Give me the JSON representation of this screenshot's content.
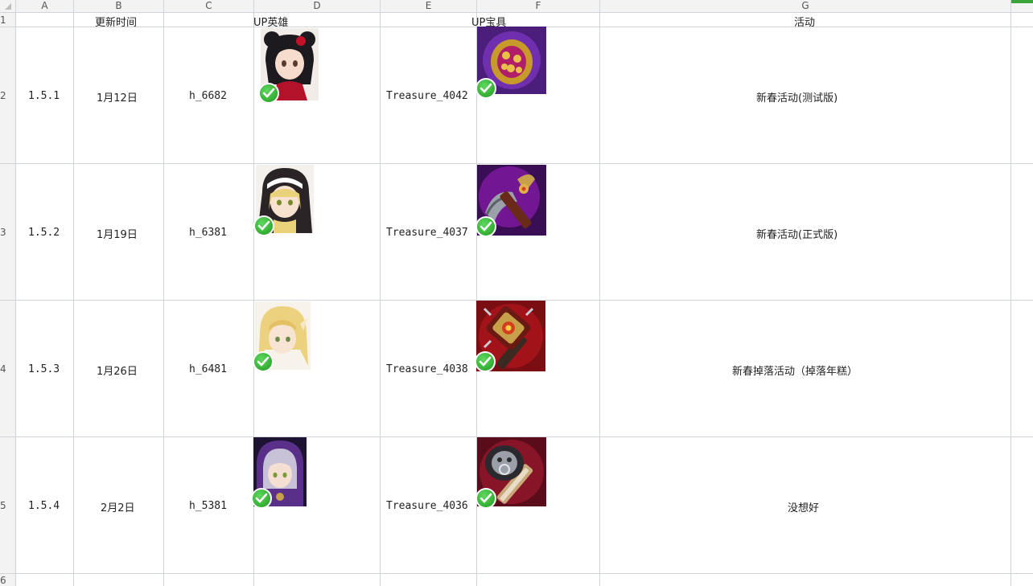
{
  "columns": [
    "A",
    "B",
    "C",
    "D",
    "E",
    "F",
    "G"
  ],
  "row_numbers": [
    "1",
    "2",
    "3",
    "4",
    "5",
    "6"
  ],
  "header": {
    "update_time": "更新时间",
    "up_hero": "UP英雄",
    "up_treasure": "UP宝具",
    "activity": "活动"
  },
  "rows": [
    {
      "version": "1.5.1",
      "date": "1月12日",
      "hero": "h_6682",
      "treasure": "Treasure_4042",
      "activity": "新春活动(测试版)"
    },
    {
      "version": "1.5.2",
      "date": "1月19日",
      "hero": "h_6381",
      "treasure": "Treasure_4037",
      "activity": "新春活动(正式版)"
    },
    {
      "version": "1.5.3",
      "date": "1月26日",
      "hero": "h_6481",
      "treasure": "Treasure_4038",
      "activity": "新春掉落活动（掉落年糕）"
    },
    {
      "version": "1.5.4",
      "date": "2月2日",
      "hero": "h_5381",
      "treasure": "Treasure_4036",
      "activity": "没想好"
    }
  ],
  "images": {
    "hero_icons": [
      "anime-girl-black-hair-icon",
      "nun-blonde-girl-icon",
      "blonde-girl-icon",
      "purple-hood-girl-icon"
    ],
    "treasure_icons": [
      "gold-gem-orb-icon",
      "dragon-axe-icon",
      "red-spiked-hammer-icon",
      "silver-lion-hammer-icon"
    ],
    "check_badge": "green-checkmark-icon"
  },
  "colors": {
    "grid": "#cfd3da",
    "header_bg": "#f3f3f3",
    "check_green": "#2fae2f"
  }
}
